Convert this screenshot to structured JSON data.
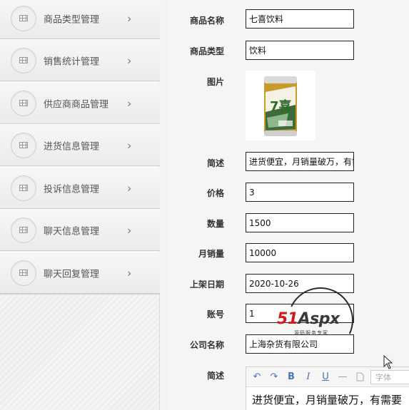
{
  "sidebar": {
    "items": [
      {
        "label": "商品类型管理"
      },
      {
        "label": "销售统计管理"
      },
      {
        "label": "供应商商品管理"
      },
      {
        "label": "进货信息管理"
      },
      {
        "label": "投诉信息管理"
      },
      {
        "label": "聊天信息管理"
      },
      {
        "label": "聊天回复管理"
      }
    ],
    "chevron": "›"
  },
  "form": {
    "name_label": "商品名称",
    "name_value": "七喜饮料",
    "type_label": "商品类型",
    "type_value": "饮料",
    "image_label": "图片",
    "summary_label": "简述",
    "summary_value": "进货便宜，月销量破万，有需要",
    "price_label": "价格",
    "price_value": "3",
    "qty_label": "数量",
    "qty_value": "1500",
    "monthly_label": "月销量",
    "monthly_value": "10000",
    "date_label": "上架日期",
    "date_value": "2020-10-26",
    "account_label": "账号",
    "account_value": "1",
    "company_label": "公司名称",
    "company_value": "上海杂货有限公司",
    "desc_label": "简述"
  },
  "editor": {
    "undo": "↶",
    "redo": "↷",
    "bold": "B",
    "italic": "I",
    "underline": "U",
    "hr": "—",
    "font_placeholder": "字体",
    "content": "进货便宜，月销量破万，有需要"
  },
  "product_image": {
    "can_text": "7喜"
  },
  "watermark": {
    "logo_51": "51",
    "logo_aspx": "Aspx",
    "logo_x": "",
    "sub": "源码服务专家"
  },
  "colors": {
    "accent": "#4a76b8",
    "watermark_red": "#d11b1b",
    "watermark_green": "#2f9a2f"
  }
}
